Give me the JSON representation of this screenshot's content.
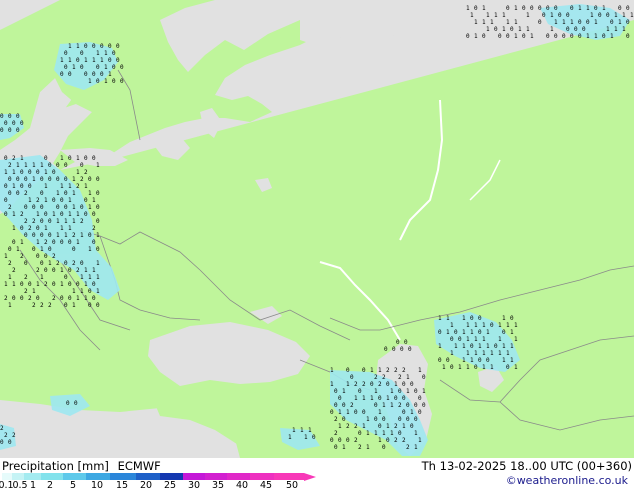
{
  "legend": {
    "title": "Precipitation [mm]",
    "model": "ECMWF",
    "ticks": [
      "0.1",
      "0.5",
      "1",
      "2",
      "5",
      "10",
      "15",
      "20",
      "25",
      "30",
      "35",
      "40",
      "45",
      "50"
    ],
    "colors": [
      "#e6fbfb",
      "#c5f3f5",
      "#a4ebf0",
      "#82e2ec",
      "#5ec9ea",
      "#3da8e2",
      "#2b86da",
      "#1e60c8",
      "#1438b0",
      "#c418d8",
      "#d220d0",
      "#e028c8",
      "#ee30c0",
      "#f838b8"
    ]
  },
  "valid_time": "Th 13-02-2025 18..00 UTC (00+360)",
  "credit": "©weatheronline.co.uk",
  "map": {
    "land_color": "#bff59b",
    "sea_color": "#e1e1e1",
    "border_color": "#8a8a8a",
    "light_precip_color": "#9ee8f1"
  }
}
